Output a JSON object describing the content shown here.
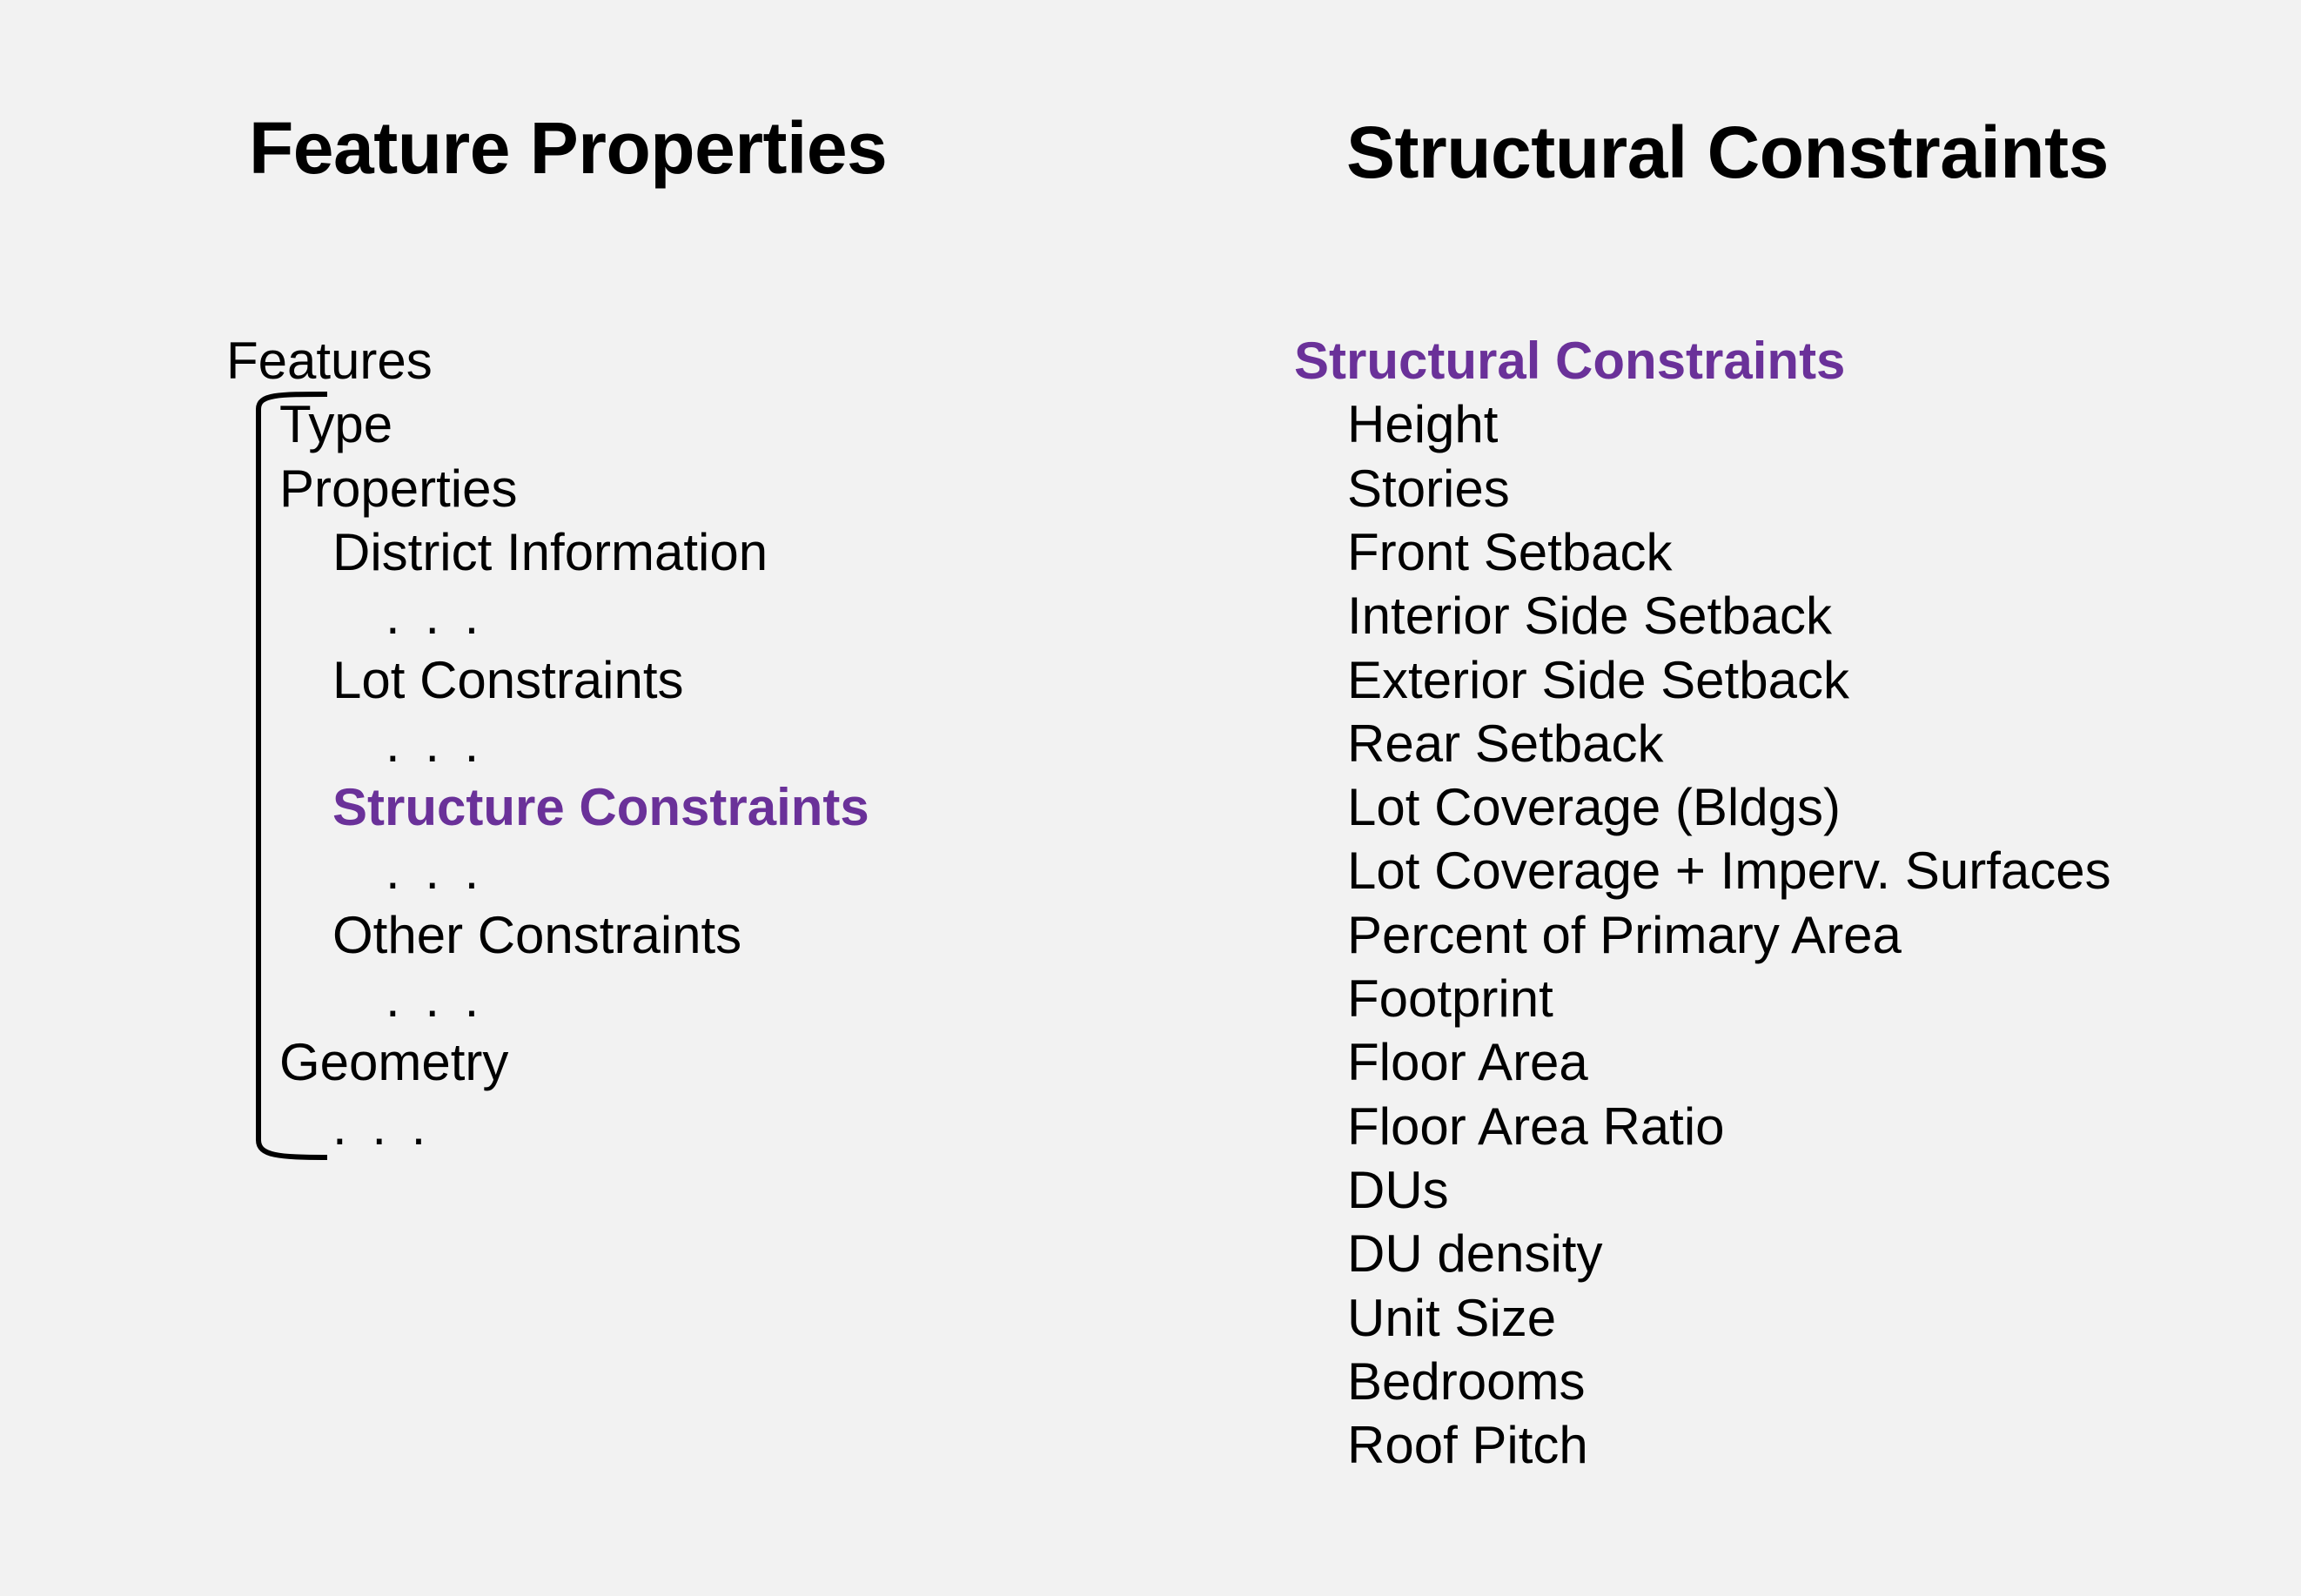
{
  "left_panel": {
    "title": "Feature Properties",
    "tree": [
      {
        "label": "Features",
        "level": 0
      },
      {
        "label": "Type",
        "level": 1
      },
      {
        "label": "Properties",
        "level": 1
      },
      {
        "label": "District Information",
        "level": 2
      },
      {
        "label": ". . .",
        "level": 3
      },
      {
        "label": "Lot Constraints",
        "level": 2
      },
      {
        "label": ". . .",
        "level": 3
      },
      {
        "label": "Structure Constraints",
        "level": 2,
        "highlight": true
      },
      {
        "label": ". . .",
        "level": 3
      },
      {
        "label": "Other Constraints",
        "level": 2
      },
      {
        "label": ". . .",
        "level": 3
      },
      {
        "label": "Geometry",
        "level": 1
      },
      {
        "label": ". . .",
        "level": 2
      }
    ]
  },
  "right_panel": {
    "title": "Structural Constraints",
    "tree": [
      {
        "label": "Structural Constraints",
        "level": 0,
        "highlight": true
      },
      {
        "label": "Height",
        "level": 1
      },
      {
        "label": "Stories",
        "level": 1
      },
      {
        "label": "Front Setback",
        "level": 1
      },
      {
        "label": "Interior Side Setback",
        "level": 1
      },
      {
        "label": "Exterior Side Setback",
        "level": 1
      },
      {
        "label": "Rear Setback",
        "level": 1
      },
      {
        "label": "Lot Coverage (Bldgs)",
        "level": 1
      },
      {
        "label": "Lot Coverage + Imperv. Surfaces",
        "level": 1
      },
      {
        "label": "Percent of Primary Area",
        "level": 1
      },
      {
        "label": "Footprint",
        "level": 1
      },
      {
        "label": "Floor Area",
        "level": 1
      },
      {
        "label": "Floor Area Ratio",
        "level": 1
      },
      {
        "label": "DUs",
        "level": 1
      },
      {
        "label": "DU density",
        "level": 1
      },
      {
        "label": "Unit Size",
        "level": 1
      },
      {
        "label": "Bedrooms",
        "level": 1
      },
      {
        "label": "Roof Pitch",
        "level": 1
      }
    ]
  },
  "colors": {
    "background": "#f2f2f2",
    "text": "#000000",
    "highlight": "#6a3199"
  }
}
